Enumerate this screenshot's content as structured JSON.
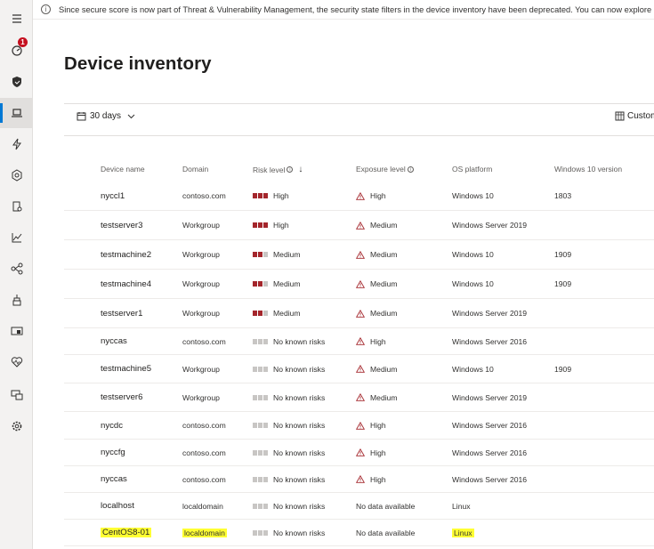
{
  "banner": {
    "text": "Since secure score is now part of Threat & Vulnerability Management, the security state filters in the device inventory have been deprecated. You can now explore security con"
  },
  "rail": {
    "items": [
      {
        "icon": "hamburger-menu-icon"
      },
      {
        "icon": "dashboard-gauge-icon",
        "badge": "1"
      },
      {
        "icon": "shield-icon"
      },
      {
        "icon": "laptop-icon",
        "active": true
      },
      {
        "icon": "lightning-icon"
      },
      {
        "icon": "hexagon-icon"
      },
      {
        "icon": "report-icon"
      },
      {
        "icon": "chart-icon"
      },
      {
        "icon": "partners-icon"
      },
      {
        "icon": "evaluation-icon"
      },
      {
        "icon": "device-config-icon"
      },
      {
        "icon": "health-icon"
      },
      {
        "icon": "computers-icon"
      },
      {
        "icon": "gear-icon"
      }
    ]
  },
  "page": {
    "title": "Device inventory"
  },
  "toolbar": {
    "period_label": "30 days",
    "customize_label": "Custom"
  },
  "table": {
    "headers": {
      "device_name": "Device name",
      "domain": "Domain",
      "risk_level": "Risk level",
      "exposure_level": "Exposure level",
      "os_platform": "OS platform",
      "win10_version": "Windows 10 version"
    },
    "sort_arrow": "↓",
    "rows": [
      {
        "name": "nyccl1",
        "domain": "contoso.com",
        "risk": "High",
        "risk_bars": 3,
        "exposure": "High",
        "os": "Windows 10",
        "version": "1803"
      },
      {
        "name": "testserver3",
        "domain": "Workgroup",
        "risk": "High",
        "risk_bars": 3,
        "exposure": "Medium",
        "os": "Windows Server 2019",
        "version": ""
      },
      {
        "name": "testmachine2",
        "domain": "Workgroup",
        "risk": "Medium",
        "risk_bars": 2,
        "exposure": "Medium",
        "os": "Windows 10",
        "version": "1909"
      },
      {
        "name": "testmachine4",
        "domain": "Workgroup",
        "risk": "Medium",
        "risk_bars": 2,
        "exposure": "Medium",
        "os": "Windows 10",
        "version": "1909"
      },
      {
        "name": "testserver1",
        "domain": "Workgroup",
        "risk": "Medium",
        "risk_bars": 2,
        "exposure": "Medium",
        "os": "Windows Server 2019",
        "version": ""
      },
      {
        "name": "nyccas",
        "domain": "contoso.com",
        "risk": "No known risks",
        "risk_bars": 0,
        "exposure": "High",
        "os": "Windows Server 2016",
        "version": ""
      },
      {
        "name": "testmachine5",
        "domain": "Workgroup",
        "risk": "No known risks",
        "risk_bars": 0,
        "exposure": "Medium",
        "os": "Windows 10",
        "version": "1909"
      },
      {
        "name": "testserver6",
        "domain": "Workgroup",
        "risk": "No known risks",
        "risk_bars": 0,
        "exposure": "Medium",
        "os": "Windows Server 2019",
        "version": ""
      },
      {
        "name": "nycdc",
        "domain": "contoso.com",
        "risk": "No known risks",
        "risk_bars": 0,
        "exposure": "High",
        "os": "Windows Server 2016",
        "version": ""
      },
      {
        "name": "nyccfg",
        "domain": "contoso.com",
        "risk": "No known risks",
        "risk_bars": 0,
        "exposure": "High",
        "os": "Windows Server 2016",
        "version": ""
      },
      {
        "name": "nyccas",
        "domain": "contoso.com",
        "risk": "No known risks",
        "risk_bars": 0,
        "exposure": "High",
        "os": "Windows Server 2016",
        "version": ""
      },
      {
        "name": "localhost",
        "domain": "localdomain",
        "risk": "No known risks",
        "risk_bars": 0,
        "exposure": "No data available",
        "os": "Linux",
        "version": ""
      },
      {
        "name": "CentOS8-01",
        "domain": "localdomain",
        "risk": "No known risks",
        "risk_bars": 0,
        "exposure": "No data available",
        "os": "Linux",
        "version": "",
        "highlighted": true
      }
    ]
  },
  "colors": {
    "risk_filled": "#a4262c",
    "risk_empty": "#c8c6c4",
    "warning": "#a4262c",
    "accent": "#0078d4",
    "highlight": "#ffff33"
  }
}
